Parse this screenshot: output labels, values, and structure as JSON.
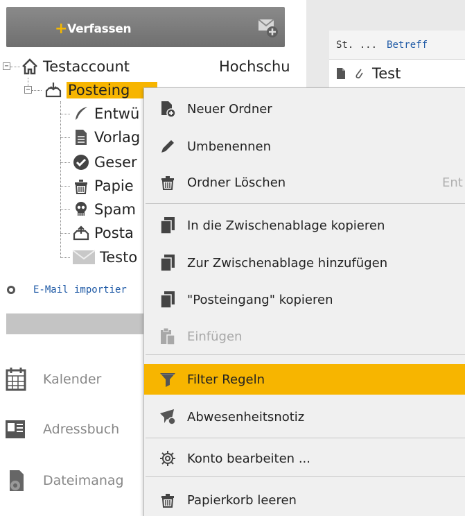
{
  "compose": {
    "label": "Verfassen",
    "plus": "+"
  },
  "tree": {
    "account": {
      "label": "Testaccount",
      "extra": "Hochschu"
    },
    "inbox": {
      "label": "Posteing"
    },
    "folders": [
      {
        "label": "Entwü",
        "icon": "feather-icon"
      },
      {
        "label": "Vorlag",
        "icon": "document-icon"
      },
      {
        "label": "Geser",
        "icon": "check-circle-icon"
      },
      {
        "label": "Papie",
        "icon": "trash-icon"
      },
      {
        "label": "Spam",
        "icon": "skull-icon"
      },
      {
        "label": "Posta",
        "icon": "outbox-icon"
      },
      {
        "label": "Testo",
        "icon": "envelope-icon"
      }
    ]
  },
  "import": {
    "label": "E-Mail importier"
  },
  "nav": [
    {
      "label": "Kalender",
      "icon": "calendar-icon"
    },
    {
      "label": "Adressbuch",
      "icon": "addressbook-icon"
    },
    {
      "label": "Dateimanag",
      "icon": "filemanager-icon"
    }
  ],
  "message_list": {
    "col_status": "St. ...",
    "col_subject": "Betreff",
    "rows": [
      {
        "subject": "Test"
      }
    ]
  },
  "context_menu": {
    "items": [
      {
        "label": "Neuer Ordner",
        "icon": "new-folder-icon"
      },
      {
        "label": "Umbenennen",
        "icon": "pencil-icon"
      },
      {
        "label": "Ordner Löschen",
        "icon": "trash-icon",
        "shortcut": "Ent"
      },
      {
        "label": "In die Zwischenablage kopieren",
        "icon": "copy-icon"
      },
      {
        "label": "Zur Zwischenablage hinzufügen",
        "icon": "copy-add-icon"
      },
      {
        "label": "\"Posteingang\" kopieren",
        "icon": "copy-icon"
      },
      {
        "label": "Einfügen",
        "icon": "paste-icon",
        "disabled": true
      },
      {
        "label": "Filter Regeln",
        "icon": "filter-icon",
        "highlighted": true
      },
      {
        "label": "Abwesenheitsnotiz",
        "icon": "away-note-icon"
      },
      {
        "label": "Konto bearbeiten ...",
        "icon": "gear-icon"
      },
      {
        "label": "Papierkorb leeren",
        "icon": "trash-icon"
      }
    ]
  },
  "colors": {
    "accent": "#f7b500",
    "link": "#1f5aa6",
    "menu_bg": "#f0f0f0"
  }
}
